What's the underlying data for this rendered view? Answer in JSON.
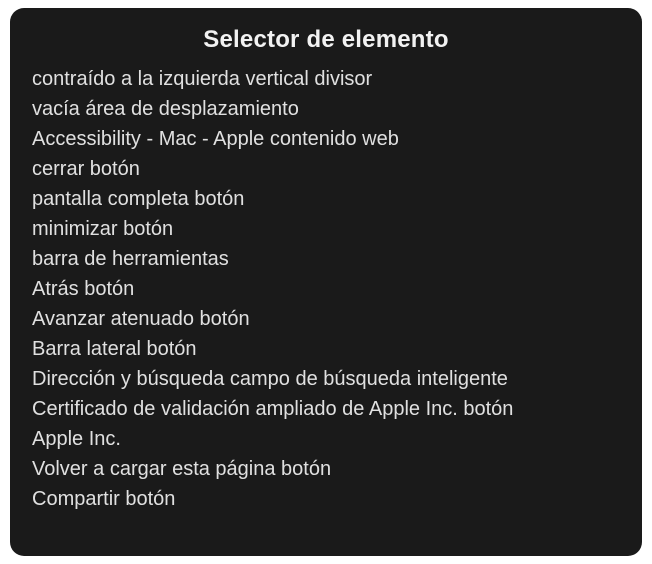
{
  "panel": {
    "title": "Selector de elemento",
    "items": [
      "contraído a la izquierda vertical divisor",
      "vacía área de desplazamiento",
      "Accessibility - Mac - Apple contenido web",
      "cerrar botón",
      "pantalla completa botón",
      "minimizar botón",
      "barra de herramientas",
      "Atrás botón",
      "Avanzar atenuado botón",
      "Barra lateral botón",
      "Dirección y búsqueda campo de búsqueda inteligente",
      "Certificado de validación ampliado de Apple Inc. botón",
      "Apple Inc.",
      "Volver a cargar esta página botón",
      "Compartir botón"
    ]
  }
}
